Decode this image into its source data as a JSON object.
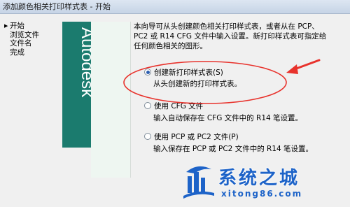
{
  "window": {
    "title": "添加颜色相关打印样式表 - 开始"
  },
  "steps": [
    {
      "label": "开始",
      "current": true
    },
    {
      "label": "浏览文件",
      "current": false
    },
    {
      "label": "文件名",
      "current": false
    },
    {
      "label": "完成",
      "current": false
    }
  ],
  "logo": {
    "text": "Autodesk",
    "color": "#1b7b6e"
  },
  "intro": {
    "line1": "本向导可从头创建颜色相关打印样式表，或者从在 PCP、",
    "line2": "PC2 或 R14 CFG 文件中输入设置。新打印样式表可指定给",
    "line3": "任何颜色相关的图形。"
  },
  "options": [
    {
      "label": "创建新打印样式表(S)",
      "desc": "从头创建新的打印样式表。",
      "selected": true
    },
    {
      "label": "使用 CFG 文件",
      "desc": "输入自动保存在 CFG 文件中的 R14 笔设置。",
      "selected": false
    },
    {
      "label": "使用 PCP 或 PC2 文件(P)",
      "desc": "输入保存在 PCP 或 PC2 文件中的 R14 笔设置。",
      "selected": false
    }
  ],
  "annotation": {
    "color": "#e8322c"
  },
  "watermark": {
    "title": "系统之城",
    "url": "xitong86.com",
    "color": "#1d63c8"
  }
}
